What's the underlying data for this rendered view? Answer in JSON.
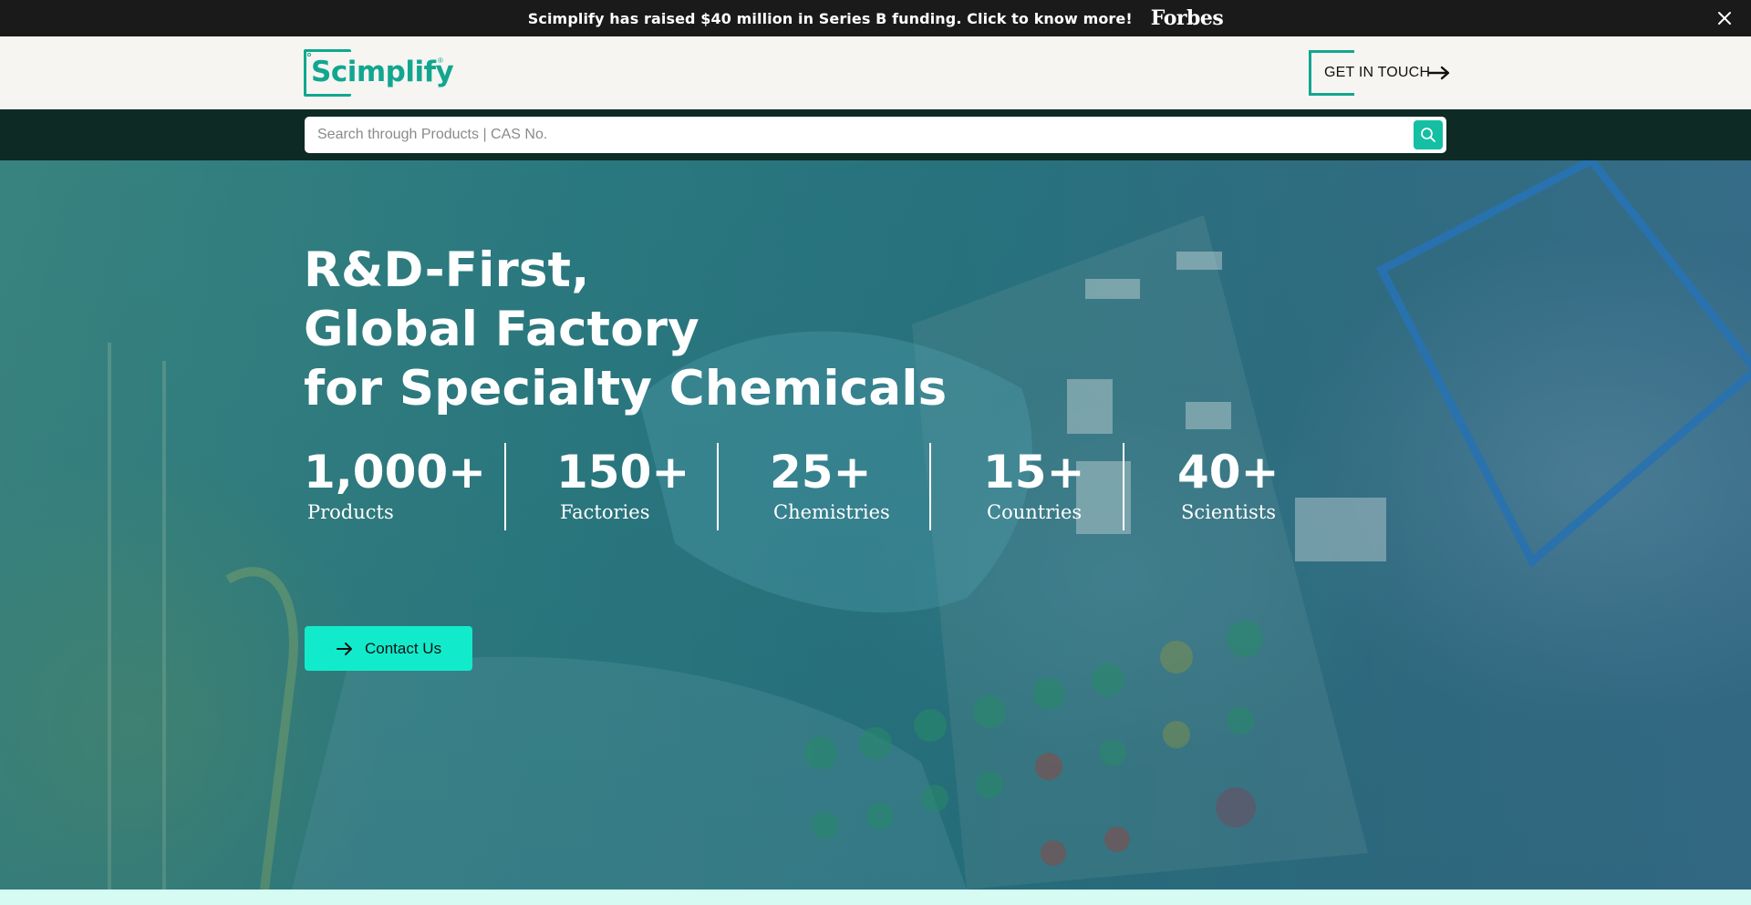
{
  "announcement": {
    "text": "Scimplify has raised $40 million in Series B funding. Click to know more!",
    "brand": "Forbes",
    "close_icon": "close-icon"
  },
  "header": {
    "logo_text": "Scimplify",
    "logo_mark": "®",
    "cta_label": "GET IN TOUCH",
    "cta_icon": "arrow-right-icon"
  },
  "search": {
    "placeholder": "Search through Products | CAS No.",
    "value": "",
    "icon": "search-icon"
  },
  "hero": {
    "title_lines": [
      "R&D-First,",
      "Global Factory",
      "for Specialty Chemicals"
    ],
    "stats": [
      {
        "value": "1,000+",
        "label": "Products"
      },
      {
        "value": "150+",
        "label": "Factories"
      },
      {
        "value": "25+",
        "label": "Chemistries"
      },
      {
        "value": "15+",
        "label": "Countries"
      },
      {
        "value": "40+",
        "label": "Scientists"
      }
    ],
    "contact_label": "Contact Us",
    "contact_icon": "arrow-right-icon"
  },
  "colors": {
    "accent": "#12a690",
    "button": "#12ebcb",
    "announcement_bg": "#1a1a1a",
    "search_band_bg": "#0e2a24",
    "header_bg": "#f6f5f2"
  }
}
